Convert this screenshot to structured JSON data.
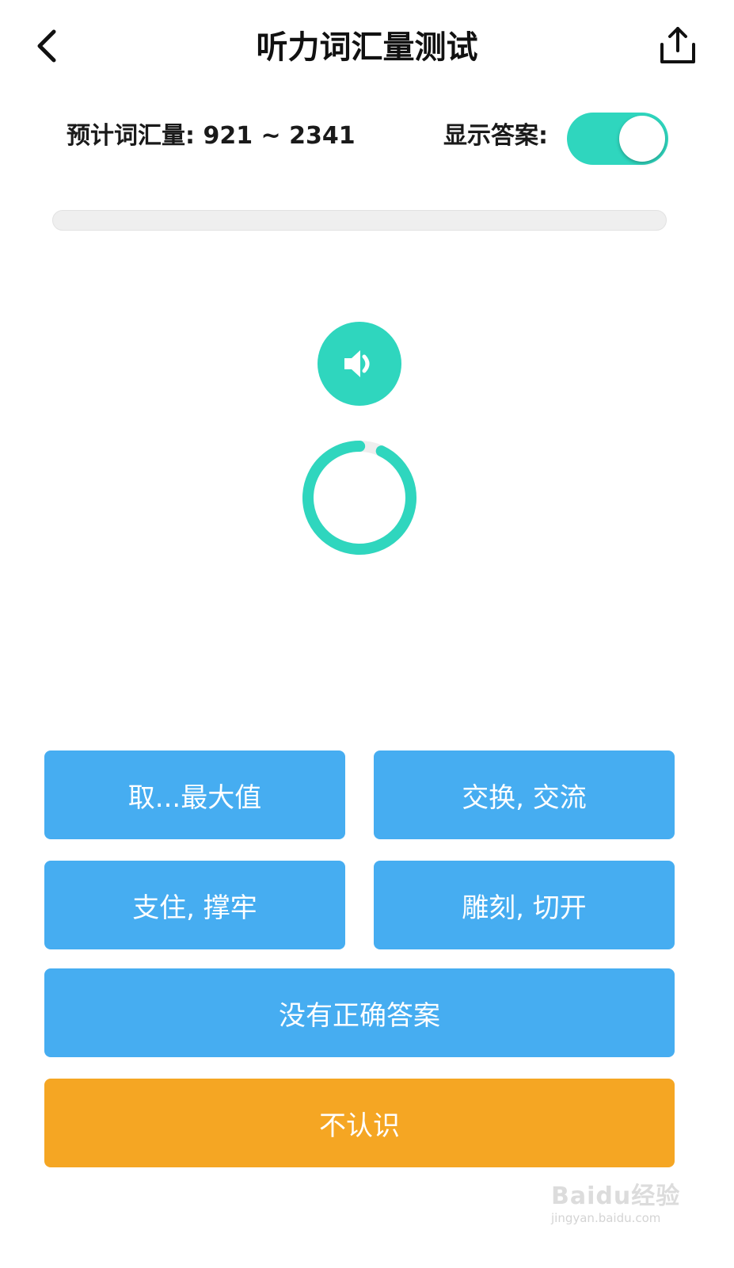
{
  "header": {
    "title": "听力词汇量测试",
    "back_icon": "chevron-left-icon",
    "share_icon": "share-upload-icon"
  },
  "estimate": {
    "label": "预计词汇量: 921 ~ 2341"
  },
  "show_answer": {
    "label": "显示答案:",
    "enabled": true
  },
  "progress": {
    "value": 0
  },
  "audio": {
    "icon": "speaker-volume-icon"
  },
  "timer": {
    "remaining_fraction": 0.93
  },
  "options": [
    {
      "label": "取...最大值"
    },
    {
      "label": "交换, 交流"
    },
    {
      "label": "支住, 撑牢"
    },
    {
      "label": "雕刻, 切开"
    }
  ],
  "none_correct": {
    "label": "没有正确答案"
  },
  "unknown": {
    "label": "不认识"
  },
  "watermark": {
    "logo_text": "Baidu经验",
    "url": "jingyan.baidu.com"
  },
  "colors": {
    "accent_teal": "#2fd6be",
    "option_blue": "#46adf1",
    "unknown_orange": "#f5a623",
    "track_gray": "#efefef"
  }
}
